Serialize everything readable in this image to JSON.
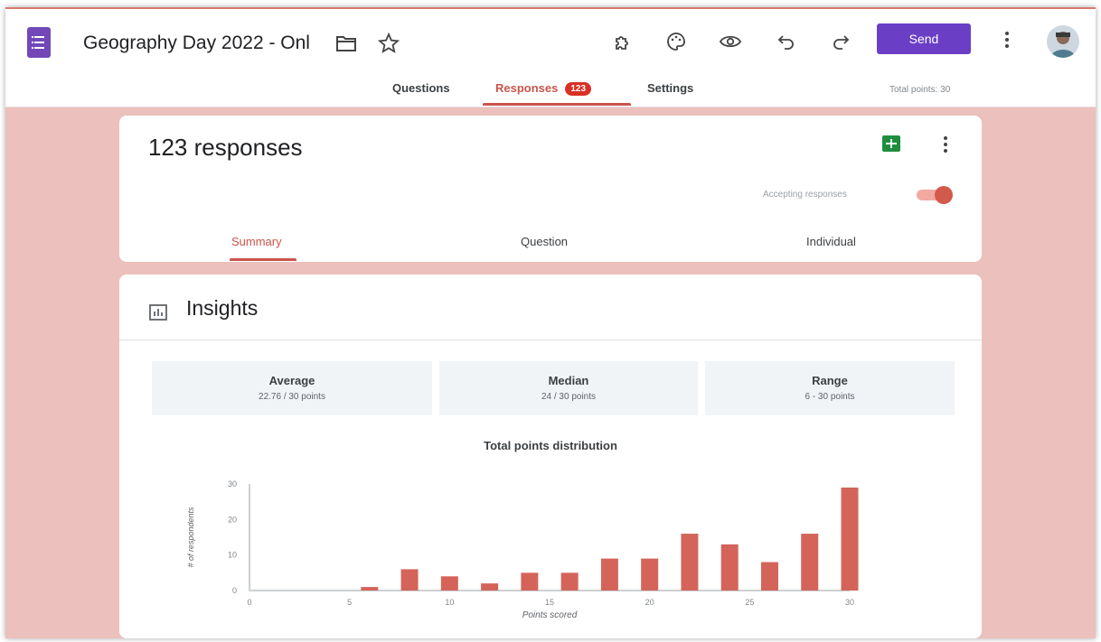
{
  "app": {
    "title": "Geography Day 2022 - Onl",
    "send_label": "Send"
  },
  "tabs": [
    {
      "label": "Questions"
    },
    {
      "label": "Responses",
      "badge": "123"
    },
    {
      "label": "Settings"
    }
  ],
  "total_points": "Total points: 30",
  "responses_card": {
    "count_label": "123 responses",
    "accepting_label": "Accepting responses",
    "accepting": true,
    "subtabs": [
      {
        "label": "Summary"
      },
      {
        "label": "Question"
      },
      {
        "label": "Individual"
      }
    ]
  },
  "insights": {
    "title": "Insights",
    "stats": [
      {
        "label": "Average",
        "value": "22.76 / 30 points"
      },
      {
        "label": "Median",
        "value": "24 / 30 points"
      },
      {
        "label": "Range",
        "value": "6 - 30 points"
      }
    ]
  },
  "colors": {
    "accent": "#c9554b",
    "bar": "#d4645a",
    "send": "#6a3fc6",
    "forms_purple": "#7248b9",
    "background": "#ecc0bc"
  },
  "chart_data": {
    "type": "bar",
    "title": "Total points distribution",
    "xlabel": "Points scored",
    "ylabel": "# of respondents",
    "xlim": [
      0,
      30
    ],
    "ylim": [
      0,
      30
    ],
    "xticks": [
      0,
      5,
      10,
      15,
      20,
      25,
      30
    ],
    "yticks": [
      0,
      10,
      20,
      30
    ],
    "grid": false,
    "x": [
      6,
      8,
      10,
      12,
      14,
      16,
      18,
      20,
      22,
      24,
      26,
      28,
      30
    ],
    "values": [
      1,
      6,
      4,
      2,
      5,
      5,
      9,
      9,
      16,
      13,
      8,
      16,
      29
    ]
  }
}
